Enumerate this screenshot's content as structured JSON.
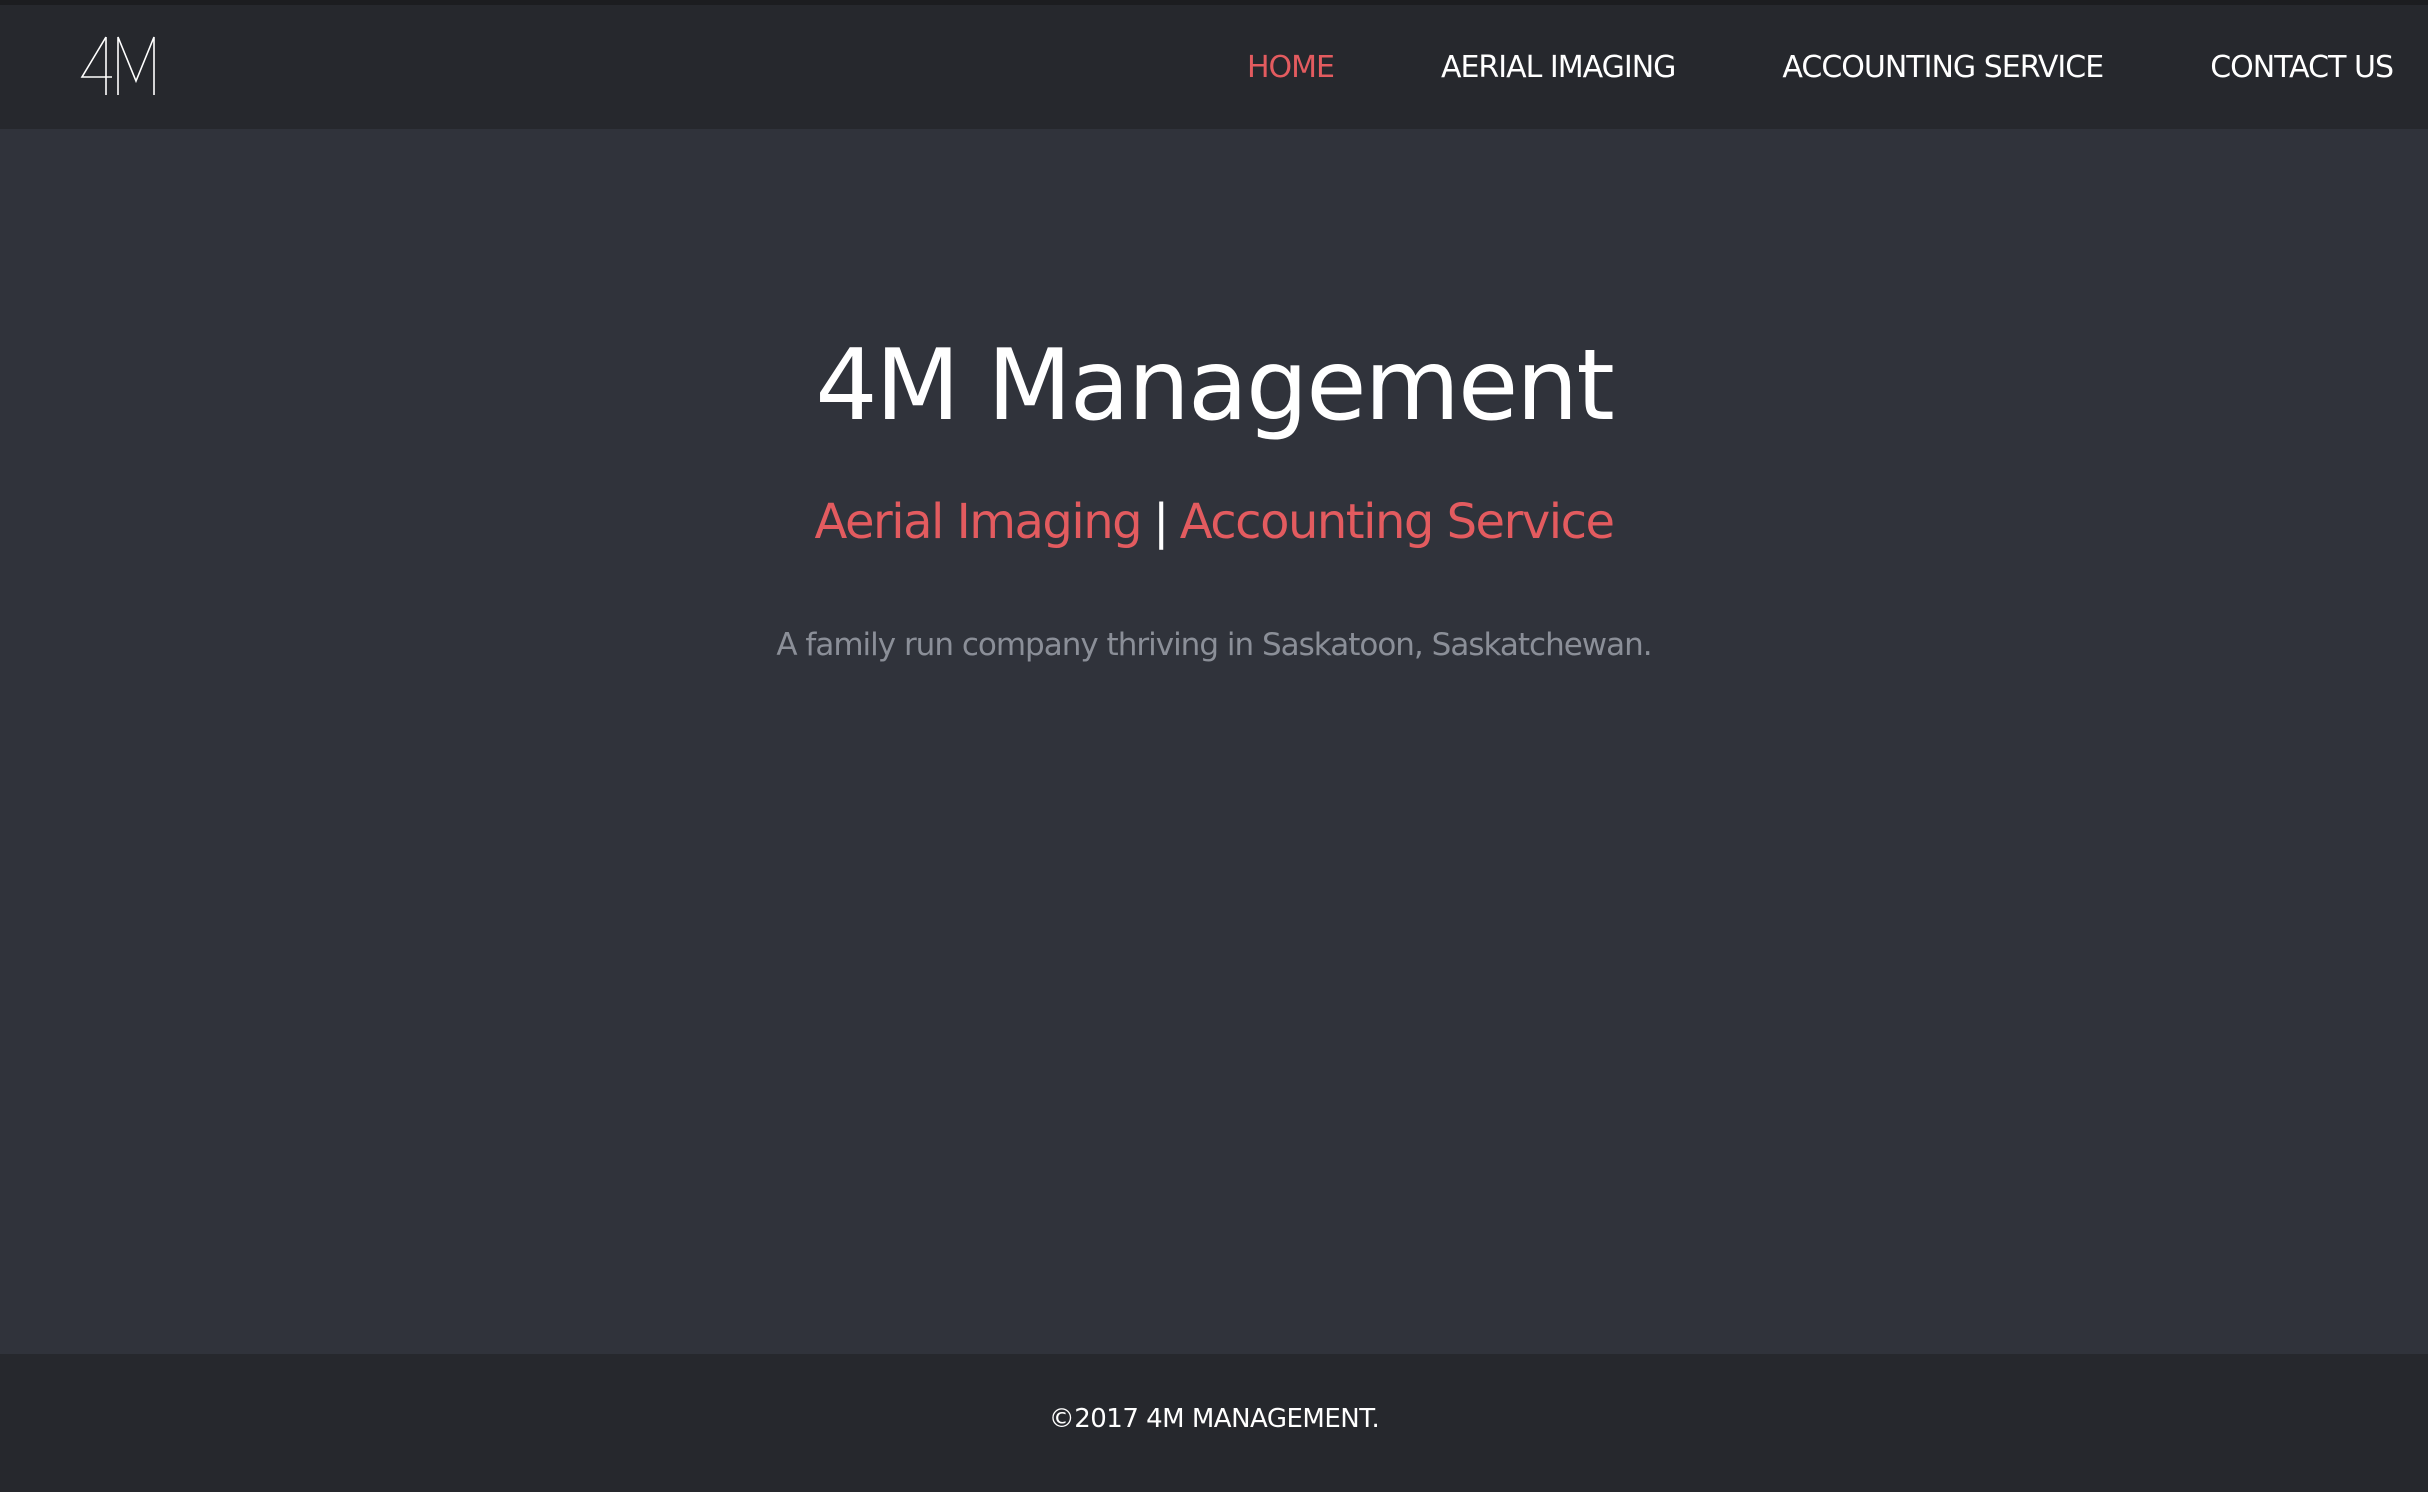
{
  "header": {
    "logo_text": "4M",
    "nav": [
      {
        "label": "HOME",
        "active": true
      },
      {
        "label": "AERIAL IMAGING",
        "active": false
      },
      {
        "label": "ACCOUNTING SERVICE",
        "active": false
      },
      {
        "label": "CONTACT US",
        "active": false
      }
    ]
  },
  "hero": {
    "title": "4M Management",
    "subtitle_left": "Aerial Imaging",
    "subtitle_separator": "|",
    "subtitle_right": "Accounting Service",
    "description": "A family run company thriving in Saskatoon, Saskatchewan."
  },
  "footer": {
    "copyright": "©2017 4M MANAGEMENT."
  },
  "colors": {
    "accent": "#e35b5f",
    "nav_bg": "#26282d",
    "main_bg": "#30333b",
    "muted_text": "#8b8f98"
  },
  "icons": {
    "logo": "4m-logo"
  }
}
